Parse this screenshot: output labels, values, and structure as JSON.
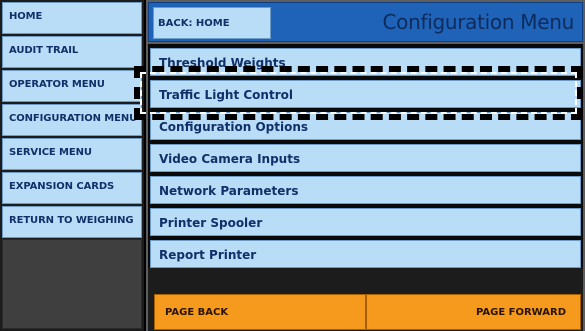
{
  "sidebar": {
    "items": [
      {
        "label": "HOME"
      },
      {
        "label": "AUDIT TRAIL"
      },
      {
        "label": "OPERATOR MENU"
      },
      {
        "label": "CONFIGURATION MENU"
      },
      {
        "label": "SERVICE MENU"
      },
      {
        "label": "EXPANSION CARDS"
      },
      {
        "label": "RETURN TO WEIGHING"
      }
    ]
  },
  "header": {
    "back_label": "BACK: HOME",
    "title": "Configuration Menu"
  },
  "menu": {
    "items": [
      {
        "label": "Threshold Weights"
      },
      {
        "label": "Traffic Light Control"
      },
      {
        "label": "Configuration Options"
      },
      {
        "label": "Video Camera Inputs"
      },
      {
        "label": "Network Parameters"
      },
      {
        "label": "Printer Spooler"
      },
      {
        "label": "Report Printer"
      }
    ],
    "selected": "Traffic Light Control"
  },
  "footer": {
    "page_back_label": "PAGE BACK",
    "page_forward_label": "PAGE FORWARD"
  },
  "colors": {
    "button_bg": "#b9ddf7",
    "header_bg": "#1f63b8",
    "text": "#11306a",
    "page_button_bg": "#f59a1c"
  }
}
